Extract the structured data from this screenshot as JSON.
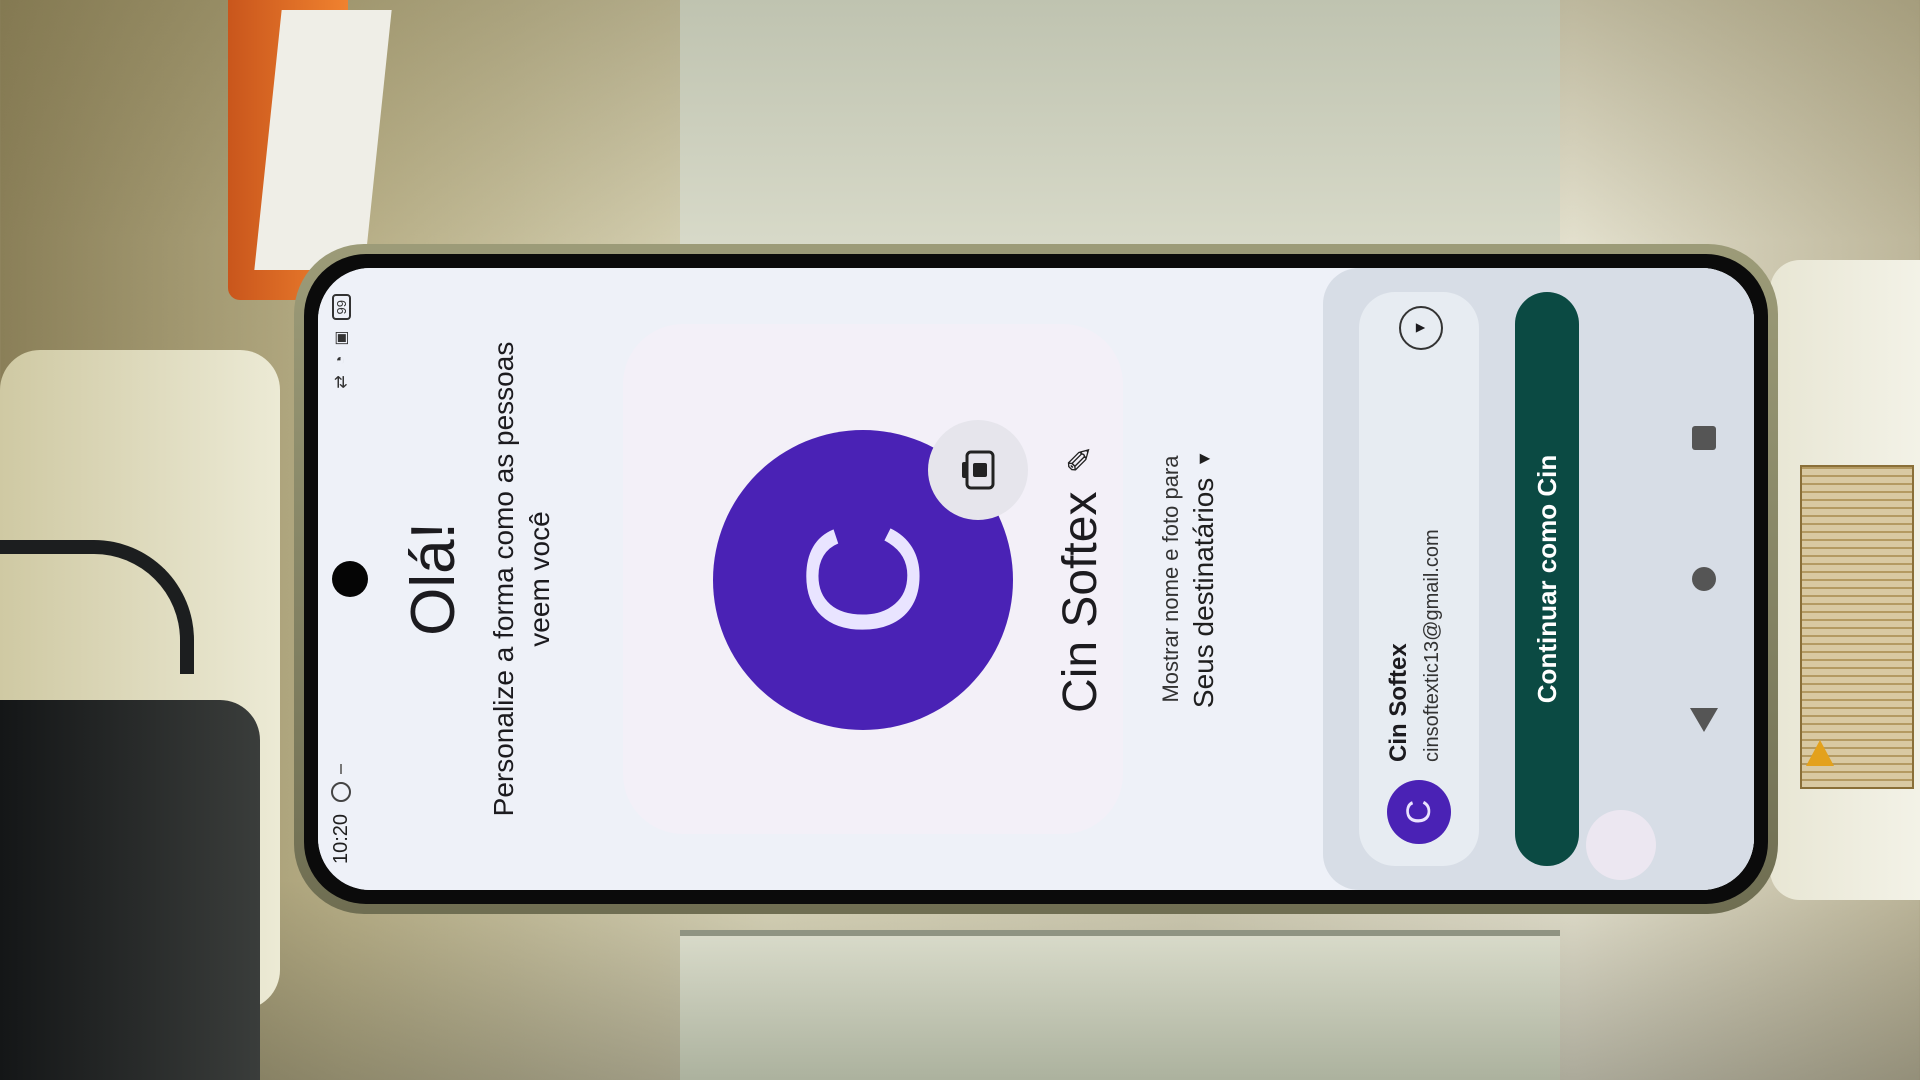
{
  "status_bar": {
    "time": "10:20",
    "battery": "99"
  },
  "page": {
    "heading": "Olá!",
    "subheading": "Personalize a forma como as pessoas veem você"
  },
  "profile": {
    "avatar_letter": "C",
    "name": "Cin Softex",
    "desc_line1": "Mostrar nome e foto para",
    "desc_line2": "Seus destinatários"
  },
  "account": {
    "avatar_letter": "C",
    "name": "Cin Softex",
    "email": "cinsoftextic13@gmail.com"
  },
  "actions": {
    "continue_label": "Continuar como Cin"
  },
  "colors": {
    "avatar": "#4a22b5",
    "button": "#0b4a43"
  }
}
